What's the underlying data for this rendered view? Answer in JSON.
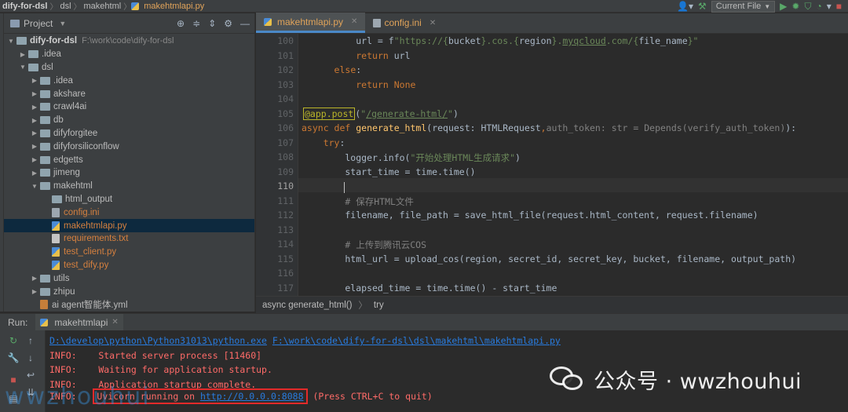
{
  "topbar": {
    "crumbs": [
      "dify-for-dsl",
      "dsl",
      "makehtml",
      "makehtmlapi.py"
    ],
    "run_config": "Current File"
  },
  "project": {
    "title": "Project",
    "tree": [
      {
        "label": "dify-for-dsl",
        "path": "F:\\work\\code\\dify-for-dsl",
        "depth": 0,
        "type": "folder",
        "open": true
      },
      {
        "label": ".idea",
        "depth": 1,
        "type": "folder"
      },
      {
        "label": "dsl",
        "depth": 1,
        "type": "folder",
        "open": true
      },
      {
        "label": ".idea",
        "depth": 2,
        "type": "folder"
      },
      {
        "label": "akshare",
        "depth": 2,
        "type": "folder"
      },
      {
        "label": "crawl4ai",
        "depth": 2,
        "type": "folder"
      },
      {
        "label": "db",
        "depth": 2,
        "type": "folder"
      },
      {
        "label": "difyforgitee",
        "depth": 2,
        "type": "folder"
      },
      {
        "label": "difyforsiliconflow",
        "depth": 2,
        "type": "folder"
      },
      {
        "label": "edgetts",
        "depth": 2,
        "type": "folder"
      },
      {
        "label": "jimeng",
        "depth": 2,
        "type": "folder"
      },
      {
        "label": "makehtml",
        "depth": 2,
        "type": "folder",
        "open": true
      },
      {
        "label": "html_output",
        "depth": 3,
        "type": "folder-leaf"
      },
      {
        "label": "config.ini",
        "depth": 3,
        "type": "ini"
      },
      {
        "label": "makehtmlapi.py",
        "depth": 3,
        "type": "py",
        "selected": true
      },
      {
        "label": "requirements.txt",
        "depth": 3,
        "type": "txt"
      },
      {
        "label": "test_client.py",
        "depth": 3,
        "type": "py"
      },
      {
        "label": "test_dify.py",
        "depth": 3,
        "type": "py"
      },
      {
        "label": "utils",
        "depth": 2,
        "type": "folder"
      },
      {
        "label": "zhipu",
        "depth": 2,
        "type": "folder"
      },
      {
        "label": "ai agent智能体.yml",
        "depth": 2,
        "type": "yml"
      }
    ]
  },
  "editor": {
    "tabs": [
      {
        "label": "makehtmlapi.py",
        "active": true
      },
      {
        "label": "config.ini",
        "active": false
      }
    ],
    "line_numbers": [
      "100",
      "101",
      "102",
      "103",
      "104",
      "105",
      "106",
      "107",
      "108",
      "109",
      "110",
      "111",
      "112",
      "113",
      "114",
      "115",
      "116",
      "117"
    ],
    "current_line": "110",
    "breadcrumb": [
      "async generate_html()",
      "try"
    ]
  },
  "run": {
    "label": "Run:",
    "tab": "makehtmlapi",
    "python_exe": "D:\\develop\\python\\Python31013\\python.exe",
    "script_path": "F:\\work\\code\\dify-for-dsl\\dsl\\makehtml\\makehtmlapi.py",
    "lines": [
      {
        "level": "INFO:",
        "msg": "Started server process [11460]"
      },
      {
        "level": "INFO:",
        "msg": "Waiting for application startup."
      },
      {
        "level": "INFO:",
        "msg": "Application startup complete."
      }
    ],
    "uvicorn_prefix": "Uvicorn running on ",
    "uvicorn_url": "http://0.0.0.0:8088",
    "uvicorn_suffix": " (Press CTRL+C to quit)"
  },
  "watermark": {
    "text": "公众号 · wwzhouhui",
    "left_text": "wwzhouhui"
  },
  "colors": {
    "accent": "#4a88c7",
    "highlight_box": "#e32a2a",
    "info_red": "#ff6b68",
    "link": "#287bde"
  }
}
